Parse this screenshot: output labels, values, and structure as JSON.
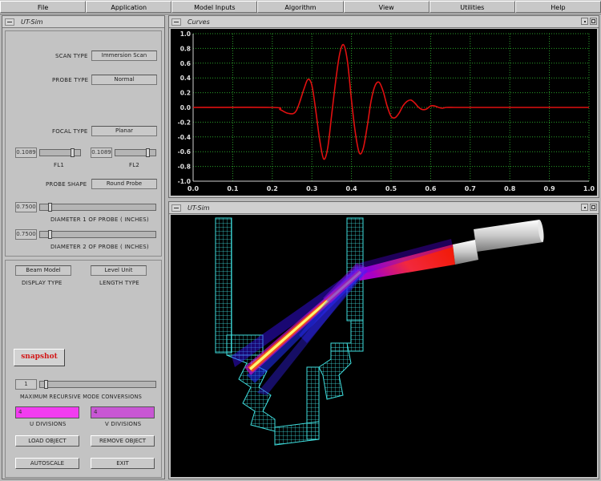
{
  "menubar": [
    "File",
    "Application",
    "Model Inputs",
    "Algorithm",
    "View",
    "Utilities",
    "Help"
  ],
  "left_window": {
    "title": "UT-Sim",
    "scan_type": {
      "label": "SCAN TYPE",
      "value": "Immersion Scan"
    },
    "probe_type": {
      "label": "PROBE TYPE",
      "value": "Normal"
    },
    "focal_type": {
      "label": "FOCAL TYPE",
      "value": "Planar"
    },
    "fl1": {
      "label": "FL1",
      "value": "0.1089"
    },
    "fl2": {
      "label": "FL2",
      "value": "0.1089"
    },
    "probe_shape": {
      "label": "PROBE SHAPE",
      "value": "Round Probe"
    },
    "diameter1": {
      "label": "DIAMETER 1 OF PROBE ( INCHES)",
      "value": "0.7500"
    },
    "diameter2": {
      "label": "DIAMETER 2 OF PROBE ( INCHES)",
      "value": "0.7500"
    },
    "display_type": {
      "label": "DISPLAY TYPE",
      "value": "Beam Model"
    },
    "length_type": {
      "label": "LENGTH TYPE",
      "value": "Level Unit"
    },
    "snapshot_label": "snapshot",
    "max_recursive": {
      "label": "MAXIMUM RECURSIVE MODE CONVERSIONS",
      "value": "1"
    },
    "u_divisions": {
      "label": "U DIVISIONS",
      "value": "4"
    },
    "v_divisions": {
      "label": "V DIVISIONS",
      "value": "4"
    },
    "load_object": "LOAD OBJECT",
    "remove_object": "REMOVE OBJECT",
    "autoscale": "AUTOSCALE",
    "exit": "EXIT"
  },
  "curves_window": {
    "title": "Curves"
  },
  "sim_window": {
    "title": "UT-Sim"
  },
  "chart_data": {
    "type": "line",
    "title": "",
    "xlabel": "",
    "ylabel": "",
    "xlim": [
      0.0,
      1.0
    ],
    "ylim": [
      -1.0,
      1.0
    ],
    "x_ticks": [
      "0.0",
      "0.1",
      "0.2",
      "0.3",
      "0.4",
      "0.5",
      "0.6",
      "0.7",
      "0.8",
      "0.9",
      "1.0"
    ],
    "y_ticks": [
      "1.0",
      "0.8",
      "0.6",
      "0.4",
      "0.2",
      "0.0",
      "-0.2",
      "-0.4",
      "-0.6",
      "-0.8",
      "-1.0"
    ],
    "grid": true,
    "series": [
      {
        "color": "#e01010",
        "x": [
          0.0,
          0.2,
          0.22,
          0.24,
          0.26,
          0.28,
          0.29,
          0.3,
          0.31,
          0.32,
          0.33,
          0.34,
          0.35,
          0.36,
          0.37,
          0.38,
          0.39,
          0.4,
          0.41,
          0.42,
          0.43,
          0.44,
          0.45,
          0.46,
          0.47,
          0.48,
          0.49,
          0.5,
          0.51,
          0.52,
          0.53,
          0.54,
          0.55,
          0.56,
          0.57,
          0.58,
          0.59,
          0.6,
          0.61,
          0.62,
          0.63,
          0.64,
          0.66,
          0.7,
          1.0
        ],
        "y": [
          0.0,
          0.0,
          -0.03,
          -0.08,
          -0.05,
          0.25,
          0.38,
          0.3,
          -0.05,
          -0.45,
          -0.7,
          -0.55,
          -0.1,
          0.35,
          0.72,
          0.85,
          0.62,
          0.1,
          -0.35,
          -0.62,
          -0.55,
          -0.25,
          0.1,
          0.3,
          0.34,
          0.22,
          0.02,
          -0.12,
          -0.14,
          -0.08,
          0.02,
          0.08,
          0.1,
          0.06,
          0.0,
          -0.03,
          -0.02,
          0.02,
          0.02,
          0.0,
          -0.01,
          0.0,
          0.0,
          0.0,
          0.0
        ]
      }
    ]
  }
}
